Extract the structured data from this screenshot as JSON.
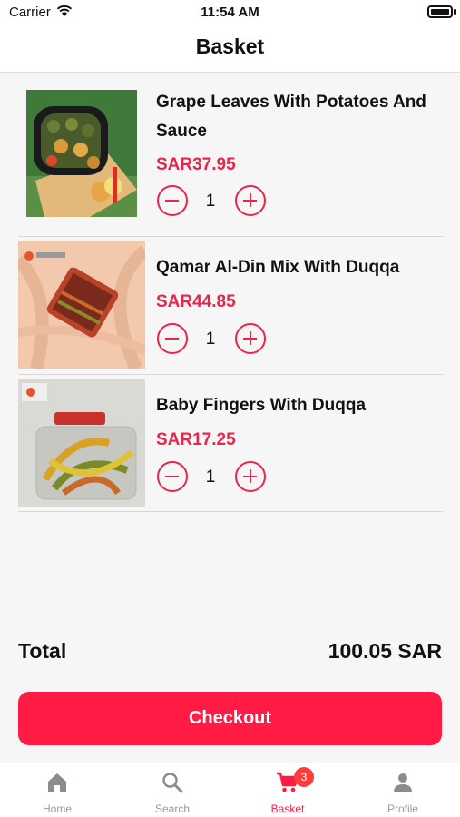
{
  "status_bar": {
    "carrier": "Carrier",
    "time": "11:54 AM"
  },
  "header": {
    "title": "Basket"
  },
  "items": [
    {
      "name": "Grape Leaves With Potatoes And Sauce",
      "price": "SAR37.95",
      "quantity": "1"
    },
    {
      "name": "Qamar Al-Din Mix With Duqqa",
      "price": "SAR44.85",
      "quantity": "1"
    },
    {
      "name": "Baby Fingers With Duqqa",
      "price": "SAR17.25",
      "quantity": "1"
    }
  ],
  "summary": {
    "total_label": "Total",
    "total_value": "100.05 SAR"
  },
  "checkout_label": "Checkout",
  "tabs": [
    {
      "label": "Home",
      "icon": "home-icon"
    },
    {
      "label": "Search",
      "icon": "search-icon"
    },
    {
      "label": "Basket",
      "icon": "cart-icon",
      "badge": "3",
      "active": true
    },
    {
      "label": "Profile",
      "icon": "profile-icon"
    }
  ],
  "colors": {
    "accent": "#ff1b44",
    "price": "#e8254a",
    "badge": "#ff3b3b",
    "inactive_tab": "#999999"
  }
}
